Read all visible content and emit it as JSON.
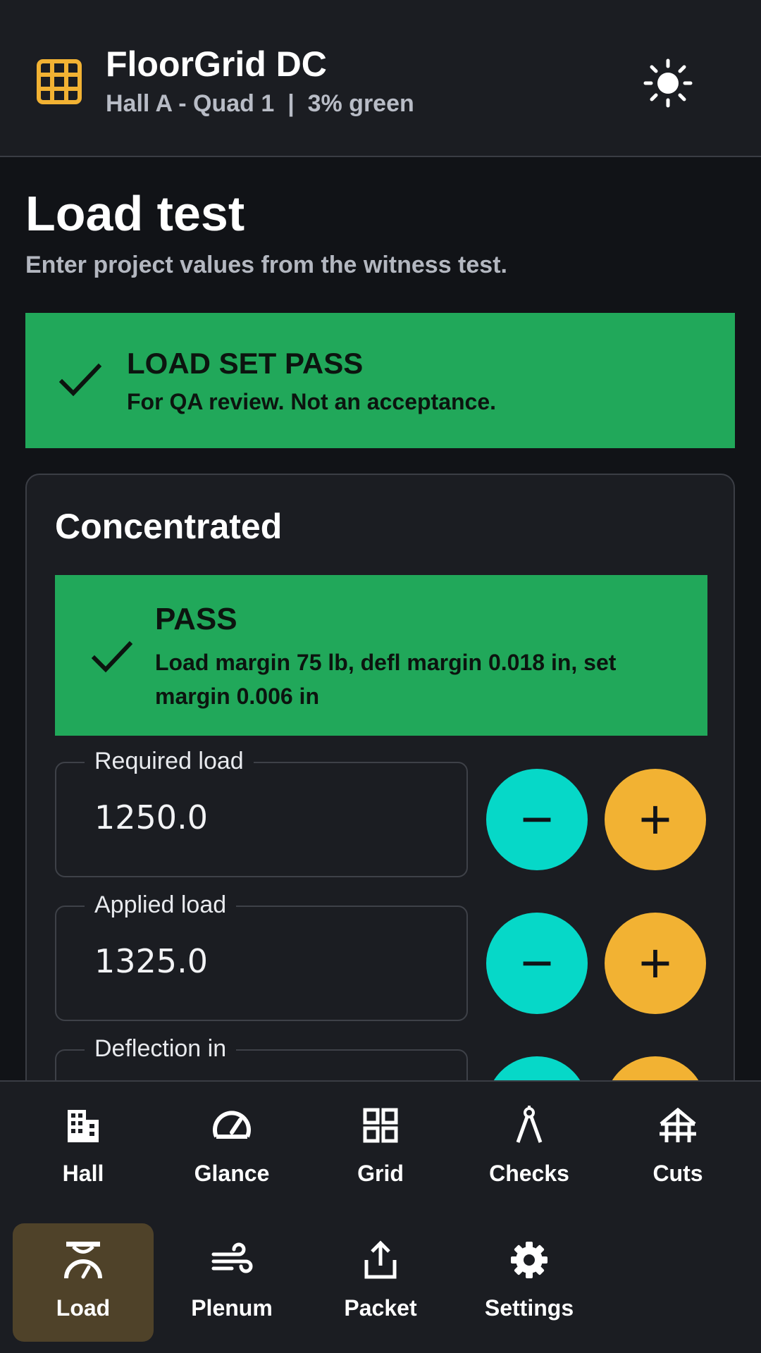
{
  "header": {
    "title": "FloorGrid DC",
    "subtitle": "Hall A - Quad 1  |  3% green",
    "logo_icon": "grid-icon",
    "theme_icon": "sun-icon",
    "accent_color": "#f2b233"
  },
  "page": {
    "title": "Load test",
    "description": "Enter project values from the witness test."
  },
  "banner": {
    "title": "LOAD SET PASS",
    "text": "For QA review. Not an acceptance.",
    "color": "#21a85a"
  },
  "card": {
    "title": "Concentrated",
    "status": {
      "title": "PASS",
      "text": "Load margin 75 lb, defl margin 0.018 in, set margin 0.006 in"
    },
    "fields": [
      {
        "label": "Required load",
        "value": "1250.0"
      },
      {
        "label": "Applied load",
        "value": "1325.0"
      },
      {
        "label": "Deflection in",
        "value": ""
      }
    ],
    "minus_symbol": "−",
    "plus_symbol": "+",
    "minus_color": "#06d8c8",
    "plus_color": "#f2b233"
  },
  "nav": {
    "items": [
      {
        "label": "Hall",
        "icon": "building-icon"
      },
      {
        "label": "Glance",
        "icon": "gauge-icon"
      },
      {
        "label": "Grid",
        "icon": "grid-view-icon"
      },
      {
        "label": "Checks",
        "icon": "compass-icon"
      },
      {
        "label": "Cuts",
        "icon": "cuts-icon"
      },
      {
        "label": "Load",
        "icon": "scale-icon",
        "active": true
      },
      {
        "label": "Plenum",
        "icon": "wind-icon"
      },
      {
        "label": "Packet",
        "icon": "share-icon"
      },
      {
        "label": "Settings",
        "icon": "gear-icon"
      }
    ]
  }
}
